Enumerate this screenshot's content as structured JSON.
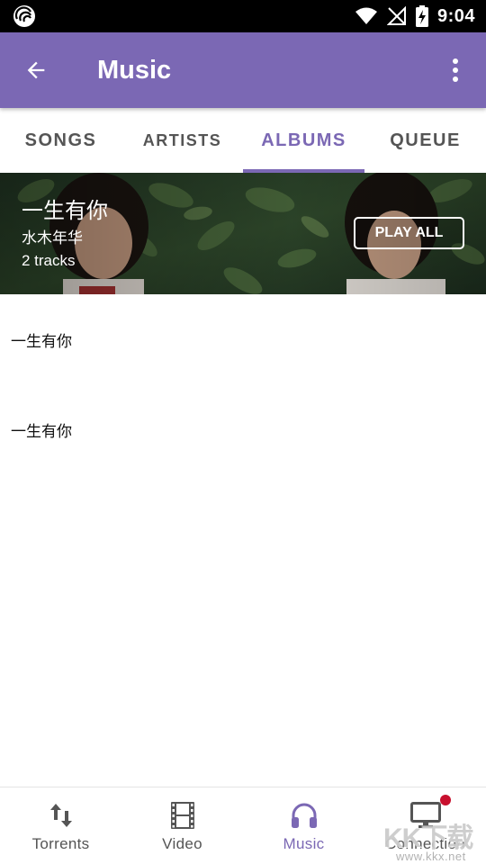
{
  "status_bar": {
    "time": "9:04",
    "icons": [
      "app-logo-icon",
      "wifi-icon",
      "no-signal-icon",
      "battery-charging-icon"
    ]
  },
  "app_bar": {
    "title": "Music",
    "back_icon": "arrow-back-icon",
    "menu_icon": "more-vert-icon",
    "background": "#7b68b4"
  },
  "tabs": [
    {
      "label": "SONGS",
      "selected": false
    },
    {
      "label": "ARTISTS",
      "selected": false
    },
    {
      "label": "ALBUMS",
      "selected": true
    },
    {
      "label": "QUEUE",
      "selected": false
    }
  ],
  "album": {
    "title": "一生有你",
    "artist": "水木年华",
    "tracks": "2 tracks",
    "play_all_label": "PLAY ALL"
  },
  "track_list": [
    {
      "title": "一生有你"
    },
    {
      "title": "一生有你"
    }
  ],
  "bottom_nav": [
    {
      "label": "Torrents",
      "icon": "swap-vert-icon",
      "active": false
    },
    {
      "label": "Video",
      "icon": "film-icon",
      "active": false
    },
    {
      "label": "Music",
      "icon": "headphones-icon",
      "active": true
    },
    {
      "label": "Connection",
      "icon": "monitor-icon",
      "active": false,
      "notification": true
    }
  ],
  "watermark": {
    "text": "KK下载",
    "url": "www.kkx.net"
  },
  "colors": {
    "accent": "#7b68b4",
    "notification": "#c8102e",
    "text_inactive": "#555555"
  }
}
